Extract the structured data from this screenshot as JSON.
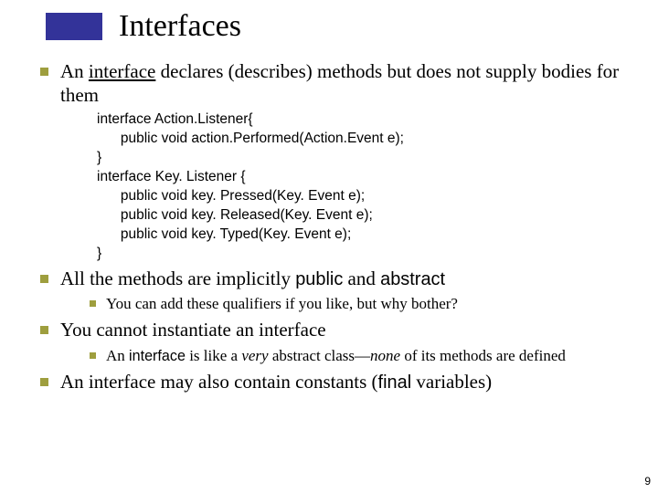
{
  "title": "Interfaces",
  "bullets": {
    "b1_pre": "An ",
    "b1_underlined": "interface",
    "b1_post": " declares (describes) methods but does not supply bodies for them",
    "code": "interface Action.Listener{\n      public void action.Performed(Action.Event e);\n}\ninterface Key. Listener {\n      public void key. Pressed(Key. Event e);\n      public void key. Released(Key. Event e);\n      public void key. Typed(Key. Event e);\n}",
    "b2_pre": "All the methods are implicitly ",
    "b2_kw1": "public",
    "b2_mid": " and ",
    "b2_kw2": "abstract",
    "b2_sub": "You can add these qualifiers if you like, but why bother?",
    "b3": "You cannot instantiate an interface",
    "b3_sub_pre": "An ",
    "b3_sub_kw": "interface",
    "b3_sub_mid1": " is like a ",
    "b3_sub_it1": "very",
    "b3_sub_mid2": " abstract class—",
    "b3_sub_it2": "none",
    "b3_sub_post": " of its methods are defined",
    "b4_pre": "An interface may also contain constants (",
    "b4_kw": "final",
    "b4_post": " variables)"
  },
  "page_number": "9"
}
